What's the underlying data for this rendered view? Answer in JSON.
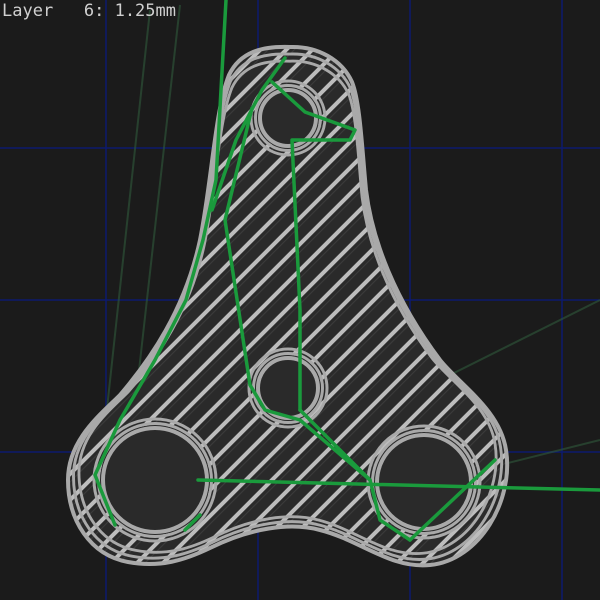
{
  "viewer": {
    "layer_label": "Layer",
    "layer_number": "6",
    "layer_height": "1.25mm",
    "readout_text": "Layer   6: 1.25mm"
  },
  "colors": {
    "background": "#1b1b1b",
    "grid": "#0c1a6e",
    "perimeter": "#a9a9a9",
    "infill": "#bdbdbd",
    "travel": "#1a9a3c",
    "travel_faint": "#2f5a3c"
  },
  "layer": {
    "number": 6,
    "height_mm": 1.25
  }
}
